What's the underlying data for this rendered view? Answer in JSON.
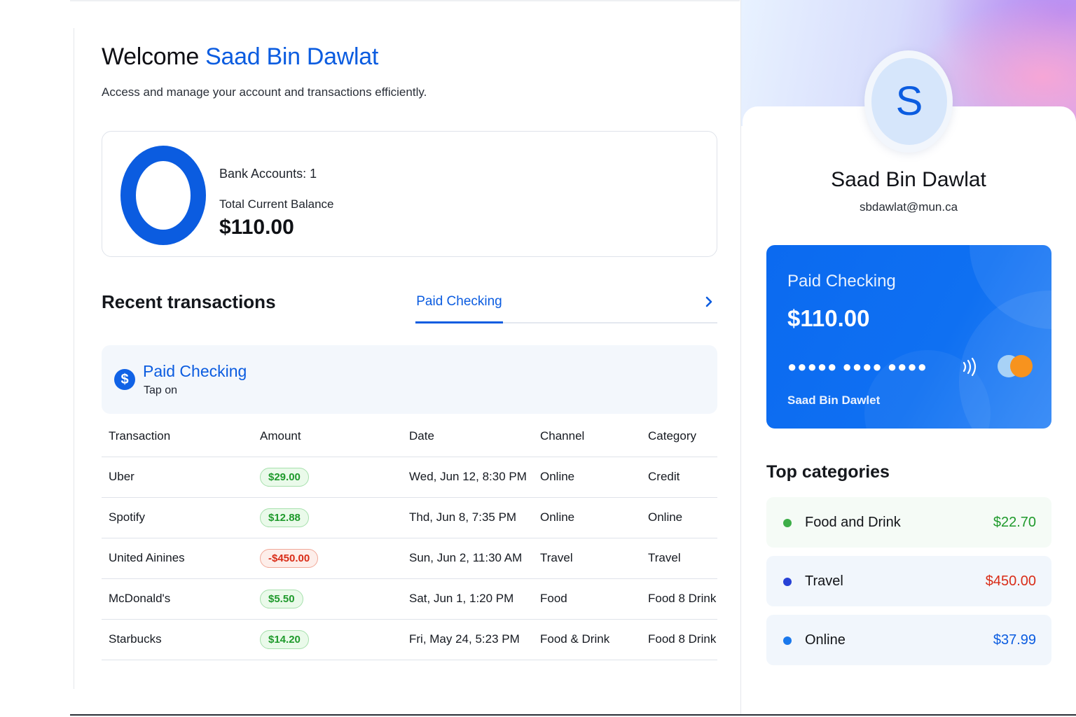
{
  "colors": {
    "brand_blue": "#0b5ce0",
    "positive_green": "#1f9a2c",
    "negative_red": "#d92c17",
    "food_dot": "#3dae48",
    "travel_dot": "#2742d6",
    "online_dot": "#1a78ec"
  },
  "header": {
    "welcome_prefix": "Welcome",
    "user_name": "Saad Bin Dawlat",
    "subtitle": "Access and manage your account and transactions efficiently."
  },
  "balance_summary": {
    "bank_accounts_text": "Bank Accounts: 1",
    "total_label": "Total Current Balance",
    "total_value": "$110.00"
  },
  "recent": {
    "title": "Recent transactions",
    "tab_label": "Paid Checking",
    "chevron_icon": "chevron-right-icon",
    "banner": {
      "icon": "dollar-icon",
      "title": "Paid Checking",
      "subtitle": "Tap on"
    },
    "columns": [
      "Transaction",
      "Amount",
      "Date",
      "Channel",
      "Category"
    ],
    "rows": [
      {
        "name": "Uber",
        "amount": "$29.00",
        "type": "pos",
        "date": "Wed, Jun 12, 8:30 PM",
        "channel": "Online",
        "category": "Credit"
      },
      {
        "name": "Spotify",
        "amount": "$12.88",
        "type": "pos",
        "date": "Thd, Jun 8, 7:35 PM",
        "channel": "Online",
        "category": "Online"
      },
      {
        "name": "United Ainines",
        "amount": "-$450.00",
        "type": "neg",
        "date": "Sun, Jun 2, 11:30 AM",
        "channel": "Travel",
        "category": "Travel"
      },
      {
        "name": "McDonald's",
        "amount": "$5.50",
        "type": "pos",
        "date": "Sat, Jun 1, 1:20 PM",
        "channel": "Food",
        "category": "Food 8 Drink"
      },
      {
        "name": "Starbucks",
        "amount": "$14.20",
        "type": "pos",
        "date": "Fri, May 24, 5:23 PM",
        "channel": "Food & Drink",
        "category": "Food 8 Drink"
      }
    ]
  },
  "profile": {
    "avatar_letter": "S",
    "name": "Saad Bin Dawlat",
    "email": "sbdawlat@mun.ca"
  },
  "card": {
    "account_name": "Paid Checking",
    "balance": "$110.00",
    "number_mask": "●●●●● ●●●● ●●●●",
    "holder": "Saad Bin Dawlet",
    "contactless_icon": "contactless-icon",
    "network_icon": "mastercard-icon"
  },
  "top_categories": {
    "title": "Top categories",
    "items": [
      {
        "label": "Food and Drink",
        "amount": "$22.70"
      },
      {
        "label": "Travel",
        "amount": "$450.00"
      },
      {
        "label": "Online",
        "amount": "$37.99"
      }
    ]
  }
}
